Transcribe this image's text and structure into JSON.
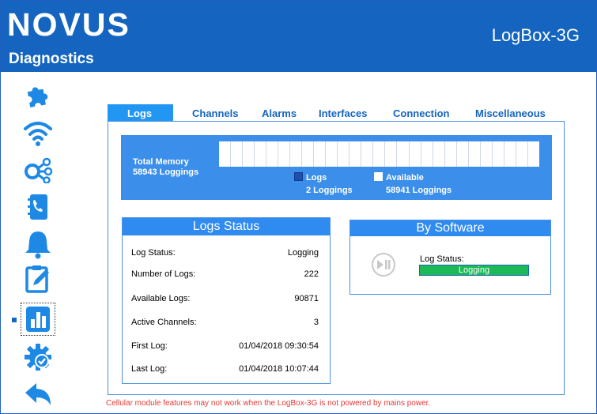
{
  "header": {
    "logo": "NOVUS",
    "section_title": "Diagnostics",
    "device_name": "LogBox-3G"
  },
  "sidebar": {
    "items": [
      {
        "id": "modules",
        "icon": "puzzle-icon"
      },
      {
        "id": "wireless",
        "icon": "wifi-icon"
      },
      {
        "id": "network",
        "icon": "network-nodes-icon"
      },
      {
        "id": "contacts",
        "icon": "phonebook-icon"
      },
      {
        "id": "alarms",
        "icon": "bell-icon"
      },
      {
        "id": "edit",
        "icon": "clipboard-edit-icon"
      },
      {
        "id": "reports",
        "icon": "bar-chart-icon",
        "selected": true
      },
      {
        "id": "settings",
        "icon": "gear-check-icon"
      },
      {
        "id": "back",
        "icon": "back-arrow-icon"
      }
    ]
  },
  "tabs": [
    {
      "label": "Logs",
      "active": true
    },
    {
      "label": "Channels"
    },
    {
      "label": "Alarms"
    },
    {
      "label": "Interfaces"
    },
    {
      "label": "Connection"
    },
    {
      "label": "Miscellaneous"
    }
  ],
  "memory": {
    "title": "Total Memory",
    "total": "58943 Loggings",
    "logs_label": "Logs",
    "logs_value": "2 Loggings",
    "available_label": "Available",
    "available_value": "58941 Loggings",
    "segments": 27
  },
  "logs_status": {
    "title": "Logs Status",
    "rows": [
      {
        "label": "Log Status:",
        "value": "Logging"
      },
      {
        "label": "Number of Logs:",
        "value": "222"
      },
      {
        "label": "Available Logs:",
        "value": "90871"
      },
      {
        "label": "Active Channels:",
        "value": "3"
      },
      {
        "label": "First Log:",
        "value": "01/04/2018 09:30:54"
      },
      {
        "label": "Last Log:",
        "value": "01/04/2018 10:07:44"
      }
    ]
  },
  "by_software": {
    "title": "By Software",
    "status_label": "Log Status:",
    "status_value": "Logging"
  },
  "warning": "Cellular module features may not work when the LogBox-3G is not powered by mains power.",
  "colors": {
    "brand_blue": "#1565c0",
    "accent_blue": "#2196f3",
    "status_green": "#1db954",
    "warning_red": "#e53935"
  }
}
